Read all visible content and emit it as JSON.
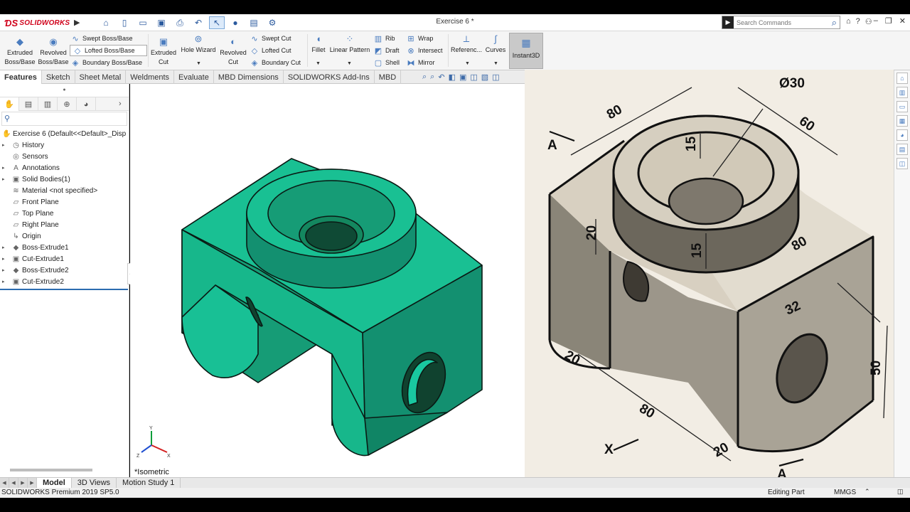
{
  "app": {
    "brand": "SOLIDWORKS",
    "window_title": "Exercise 6 *",
    "search_placeholder": "Search Commands"
  },
  "quick_access": [
    "home-icon",
    "new-icon",
    "open-icon",
    "save-icon",
    "print-icon",
    "undo-icon",
    "select-icon",
    "rebuild-icon",
    "file-properties-icon",
    "options-icon"
  ],
  "ribbon": {
    "extruded_boss": "Extruded Boss/Base",
    "revolved_boss": "Revolved Boss/Base",
    "swept_boss": "Swept Boss/Base",
    "lofted_boss": "Lofted Boss/Base",
    "boundary_boss": "Boundary Boss/Base",
    "extruded_cut": "Extruded Cut",
    "hole_wizard": "Hole Wizard",
    "revolved_cut": "Revolved Cut",
    "swept_cut": "Swept Cut",
    "lofted_cut": "Lofted Cut",
    "boundary_cut": "Boundary Cut",
    "fillet": "Fillet",
    "linear_pattern": "Linear Pattern",
    "rib": "Rib",
    "draft": "Draft",
    "shell": "Shell",
    "wrap": "Wrap",
    "intersect": "Intersect",
    "mirror": "Mirror",
    "reference": "Referenc...",
    "curves": "Curves",
    "instant3d": "Instant3D"
  },
  "tabs": [
    "Features",
    "Sketch",
    "Sheet Metal",
    "Weldments",
    "Evaluate",
    "MBD Dimensions",
    "SOLIDWORKS Add-Ins",
    "MBD"
  ],
  "feature_tree": {
    "root": "Exercise 6  (Default<<Default>_Disp",
    "items": [
      {
        "label": "History",
        "icon": "history-icon",
        "expand": true
      },
      {
        "label": "Sensors",
        "icon": "sensor-icon",
        "expand": false
      },
      {
        "label": "Annotations",
        "icon": "annotations-icon",
        "expand": true
      },
      {
        "label": "Solid Bodies(1)",
        "icon": "solid-bodies-icon",
        "expand": true
      },
      {
        "label": "Material <not specified>",
        "icon": "material-icon",
        "expand": false
      },
      {
        "label": "Front Plane",
        "icon": "plane-icon",
        "expand": false
      },
      {
        "label": "Top Plane",
        "icon": "plane-icon",
        "expand": false
      },
      {
        "label": "Right Plane",
        "icon": "plane-icon",
        "expand": false
      },
      {
        "label": "Origin",
        "icon": "origin-icon",
        "expand": false
      },
      {
        "label": "Boss-Extrude1",
        "icon": "extrude-icon",
        "expand": true
      },
      {
        "label": "Cut-Extrude1",
        "icon": "cut-extrude-icon",
        "expand": true
      },
      {
        "label": "Boss-Extrude2",
        "icon": "extrude-icon",
        "expand": true
      },
      {
        "label": "Cut-Extrude2",
        "icon": "cut-extrude-icon",
        "expand": true
      }
    ]
  },
  "viewport": {
    "view_label": "*Isometric",
    "model_color": "#17c596"
  },
  "reference_drawing": {
    "dims": [
      "Ø30",
      "80",
      "60",
      "15",
      "20",
      "15",
      "80",
      "32",
      "20",
      "80",
      "50",
      "20"
    ],
    "labels": [
      "A",
      "X",
      "A"
    ]
  },
  "bottom_tabs": [
    "Model",
    "3D Views",
    "Motion Study 1"
  ],
  "status": {
    "product": "SOLIDWORKS Premium 2019 SP5.0",
    "mode": "Editing Part",
    "units": "MMGS"
  }
}
